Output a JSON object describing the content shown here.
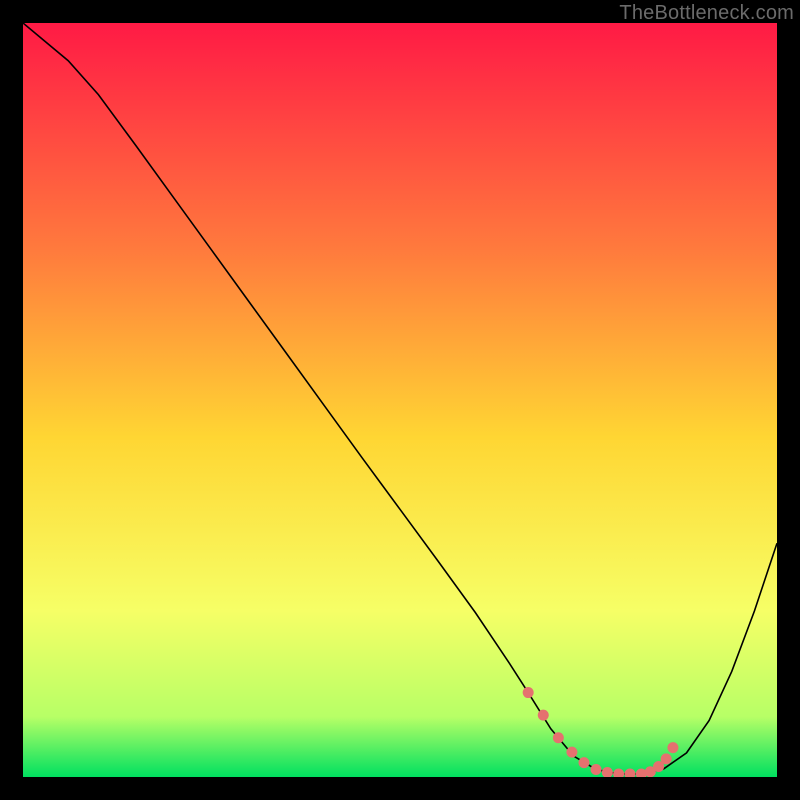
{
  "watermark": "TheBottleneck.com",
  "chart_data": {
    "type": "line",
    "title": "",
    "xlabel": "",
    "ylabel": "",
    "xlim": [
      0,
      100
    ],
    "ylim": [
      0,
      100
    ],
    "grid": false,
    "background_gradient": {
      "top": "#ff1a45",
      "upper_mid": "#ff7a3d",
      "mid": "#ffd633",
      "lower_mid": "#f6ff66",
      "low": "#b7ff66",
      "bottom": "#00e060"
    },
    "series": [
      {
        "name": "bottleneck-curve",
        "color": "#000000",
        "stroke_width": 1.6,
        "x": [
          0.0,
          3.0,
          6.0,
          10.0,
          15.0,
          20.0,
          25.0,
          30.0,
          35.0,
          40.0,
          45.0,
          50.0,
          55.0,
          60.0,
          64.5,
          67.0,
          70.0,
          73.0,
          76.0,
          79.0,
          82.0,
          85.0,
          88.0,
          91.0,
          94.0,
          97.0,
          100.0
        ],
        "y": [
          100.0,
          97.5,
          95.0,
          90.5,
          83.7,
          76.8,
          69.9,
          63.0,
          56.1,
          49.2,
          42.3,
          35.5,
          28.7,
          21.8,
          15.1,
          11.2,
          6.4,
          2.8,
          1.0,
          0.4,
          0.4,
          1.1,
          3.2,
          7.5,
          14.0,
          22.0,
          31.0
        ]
      },
      {
        "name": "optimal-region-markers",
        "color": "#e5716f",
        "marker_size": 5.5,
        "x": [
          67.0,
          69.0,
          71.0,
          72.8,
          74.4,
          76.0,
          77.5,
          79.0,
          80.5,
          82.0,
          83.2,
          84.3,
          85.3,
          86.2
        ],
        "y": [
          11.2,
          8.2,
          5.2,
          3.3,
          1.9,
          1.0,
          0.6,
          0.4,
          0.4,
          0.4,
          0.7,
          1.4,
          2.4,
          3.9
        ]
      }
    ]
  }
}
